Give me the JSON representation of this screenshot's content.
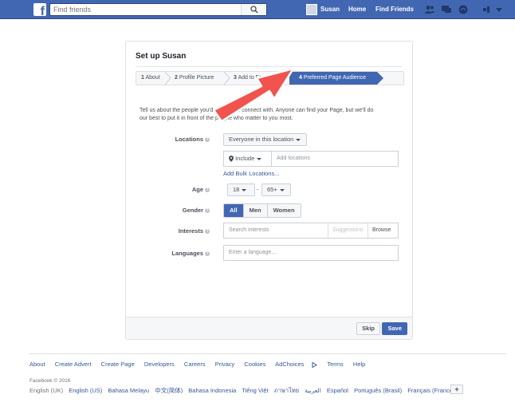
{
  "topbar": {
    "logo_letter": "f",
    "search_placeholder": "Find friends",
    "user_name": "Susan",
    "home": "Home",
    "find_friends": "Find Friends"
  },
  "card": {
    "title": "Set up Susan",
    "steps": [
      {
        "num": "1",
        "label": "About"
      },
      {
        "num": "2",
        "label": "Profile Picture"
      },
      {
        "num": "3",
        "label": "Add to Fa"
      },
      {
        "num": "4",
        "label": "Preferred Page Audience"
      }
    ],
    "intro_line1": "Tell us about the people you'd",
    "intro_line1b": "like to connect with. Anyone can find your Page, but we'll do",
    "intro_line2": "our best to put it in front of the people who matter to you most.",
    "locations_label": "Locations",
    "locations_select": "Everyone in this location",
    "include_label": "Include",
    "add_locations_placeholder": "Add locations",
    "add_bulk": "Add Bulk Locations...",
    "age_label": "Age",
    "age_min": "18",
    "age_sep": "-",
    "age_max": "65+",
    "gender_label": "Gender",
    "gender_all": "All",
    "gender_men": "Men",
    "gender_women": "Women",
    "interests_label": "Interests",
    "interests_placeholder": "Search interests",
    "suggestions": "Suggestions",
    "browse": "Browse",
    "languages_label": "Languages",
    "languages_placeholder": "Enter a language...",
    "skip": "Skip",
    "save": "Save"
  },
  "footer": {
    "links": [
      "About",
      "Create Advert",
      "Create Page",
      "Developers",
      "Careers",
      "Privacy",
      "Cookies",
      "AdChoices",
      "Terms",
      "Help"
    ],
    "copyright": "Facebook © 2016",
    "languages": [
      "English (UK)",
      "English (US)",
      "Bahasa Melayu",
      "中文(简体)",
      "Bahasa Indonesia",
      "Tiếng Việt",
      "ภาษาไทย",
      "العربية",
      "Español",
      "Português (Brasil)",
      "Français (France)"
    ],
    "plus": "+"
  },
  "colors": {
    "brand": "#4267b2",
    "arrow": "#f1534e",
    "link": "#365899"
  }
}
